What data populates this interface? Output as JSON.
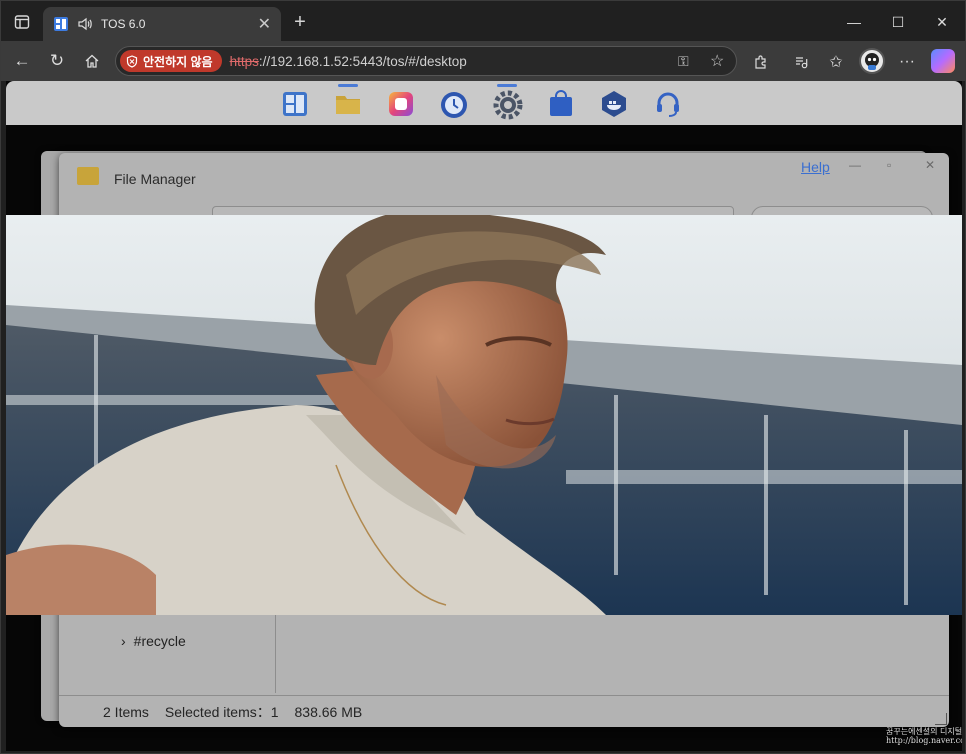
{
  "browser": {
    "tab_title": "TOS 6.0",
    "security_label": "안전하지 않음",
    "url_scheme": "https",
    "url_rest": "://192.168.1.52:5443/tos/#/desktop"
  },
  "file_manager": {
    "title": "File Manager",
    "help_label": "Help",
    "tree_item": "#recycle",
    "status": {
      "items": "2 Items",
      "selected": "Selected items：1",
      "size": "838.66 MB"
    }
  },
  "dock_icons": [
    "tos-logo-icon",
    "file-manager-icon",
    "app-center-icon",
    "backup-icon",
    "settings-icon",
    "store-icon",
    "docker-icon",
    "support-icon"
  ],
  "watermark": "꿈꾸는에센셜의 디지털 원더\nhttp://blog.naver.com/xxxxxx"
}
